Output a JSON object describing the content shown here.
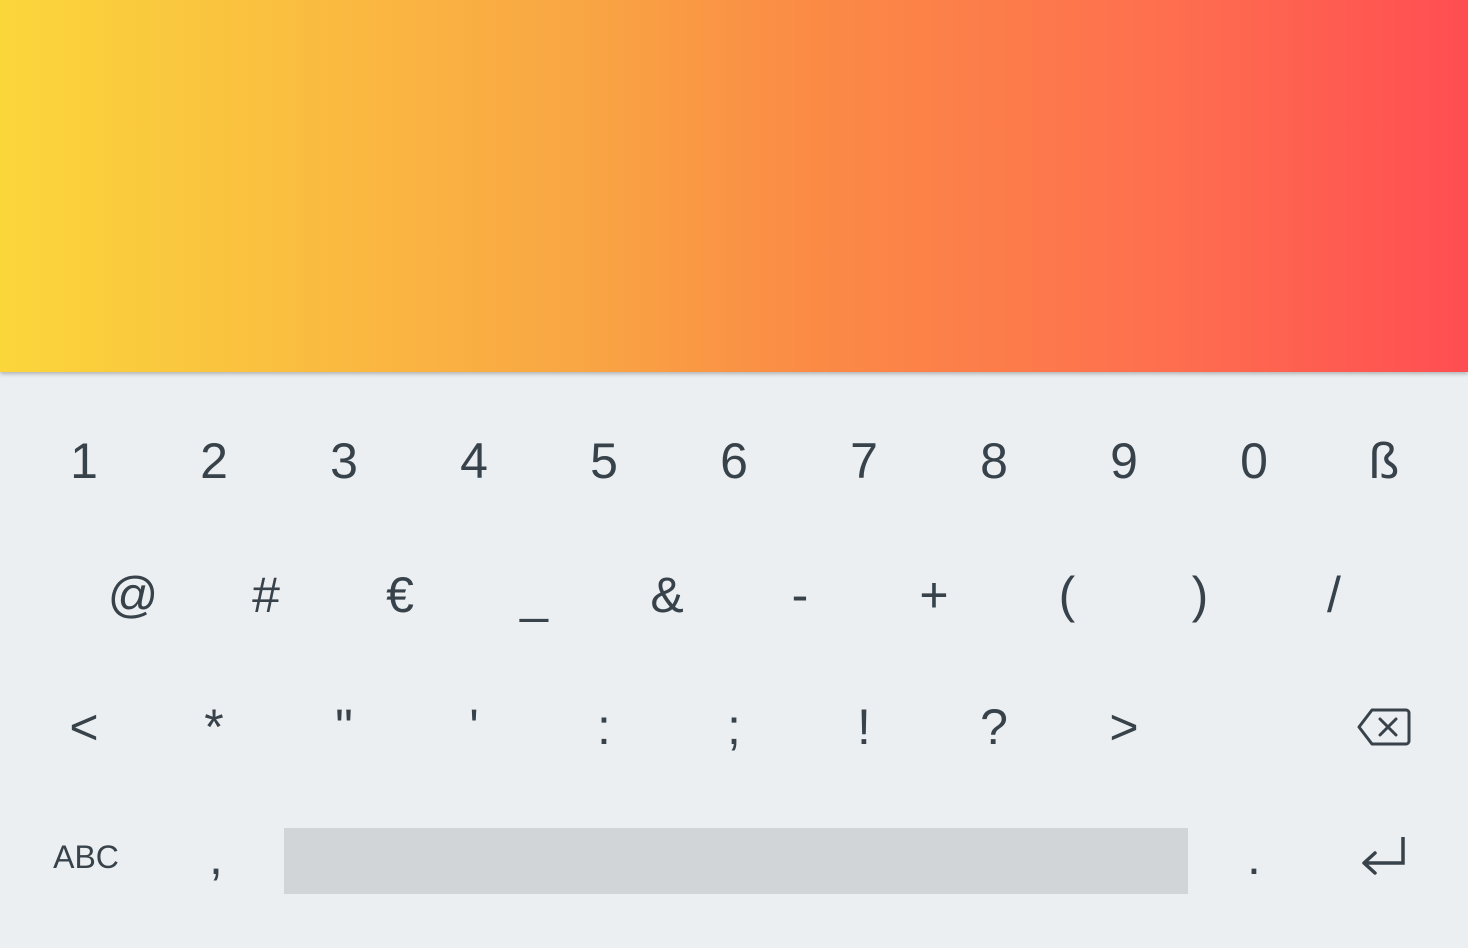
{
  "keyboard": {
    "row1": [
      "1",
      "2",
      "3",
      "4",
      "5",
      "6",
      "7",
      "8",
      "9",
      "0",
      "ß"
    ],
    "row2": [
      "@",
      "#",
      "€",
      "_",
      "&",
      "-",
      "+",
      "(",
      ")",
      "/"
    ],
    "row3": [
      "<",
      "*",
      "\"",
      "'",
      ":",
      ";",
      "!",
      "?",
      ">"
    ],
    "row4": {
      "abc_label": "ABC",
      "comma": ",",
      "period": "."
    },
    "icons": {
      "backspace": "backspace-icon",
      "enter": "enter-icon"
    }
  }
}
